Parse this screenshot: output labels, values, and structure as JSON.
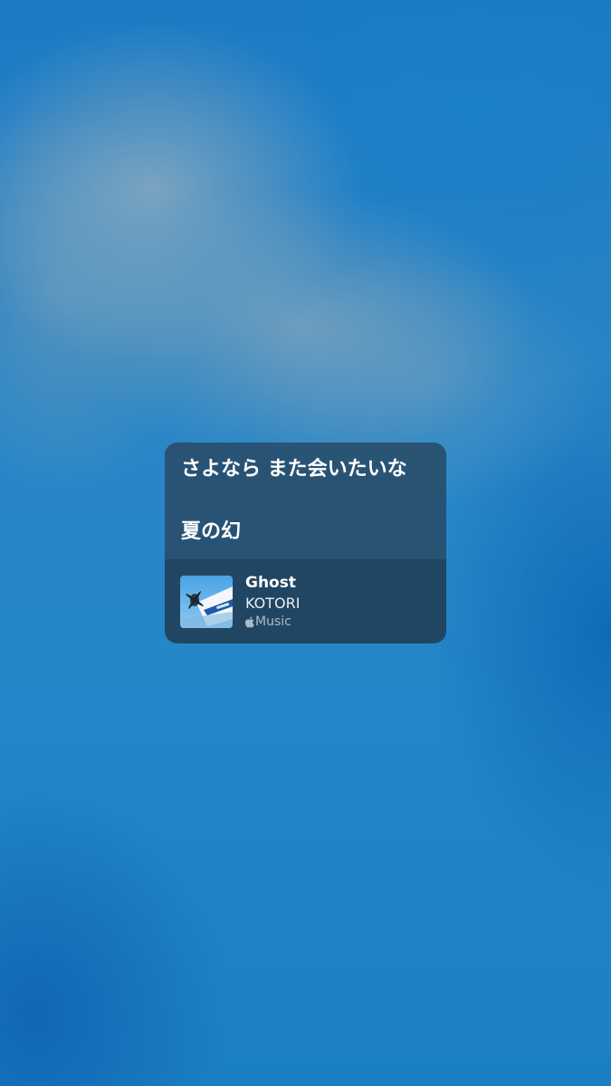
{
  "lyrics": {
    "line1": "さよなら また会いたいな",
    "line2": "夏の幻"
  },
  "track": {
    "title": "Ghost",
    "artist": "KOTORI",
    "service": "Music"
  },
  "icons": {
    "service_logo": "apple-logo-icon",
    "artwork": "album-artwork"
  },
  "colors": {
    "background": "#2287c8",
    "card": "#284862",
    "text": "#ffffff"
  }
}
